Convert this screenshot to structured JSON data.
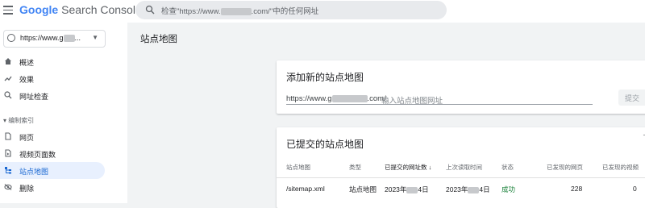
{
  "app": {
    "logo_google": "Google",
    "logo_product": "Search Console"
  },
  "search": {
    "placeholder_pre": "检查\"https://www.",
    "placeholder_post": ".com/\"中的任何网址"
  },
  "property": {
    "url_prefix": "https://www.g",
    "url_suffix": "..."
  },
  "sidebar": {
    "items": [
      {
        "label": "概述",
        "icon": "home-icon"
      },
      {
        "label": "效果",
        "icon": "trending-up-icon"
      },
      {
        "label": "网址检查",
        "icon": "search-icon"
      }
    ],
    "section_index": "编制索引",
    "index_items": [
      {
        "label": "网页",
        "icon": "file-icon"
      },
      {
        "label": "视频页面数",
        "icon": "video-file-icon"
      },
      {
        "label": "站点地图",
        "icon": "sitemap-icon",
        "active": true
      },
      {
        "label": "删除",
        "icon": "remove-visibility-icon"
      }
    ]
  },
  "page": {
    "title": "站点地图"
  },
  "add_card": {
    "title": "添加新的站点地图",
    "url_prefix_pre": "https://www.g",
    "url_prefix_post": ".com/",
    "input_placeholder": "输入站点地图网址",
    "submit_label": "提交"
  },
  "submitted_card": {
    "title": "已提交的站点地图",
    "columns": [
      "站点地图",
      "类型",
      "已提交的网址数",
      "上次读取时间",
      "状态",
      "已发现的网页",
      "已发现的视频"
    ],
    "sort_icon": "arrow-down-icon",
    "rows": [
      {
        "sitemap": "/sitemap.xml",
        "type": "站点地图",
        "submitted_pre": "2023年",
        "submitted_post": "4日",
        "last_read_pre": "2023年",
        "last_read_post": "4日",
        "status": "成功",
        "pages": "228",
        "videos": "0"
      }
    ]
  },
  "colors": {
    "accent": "#1967d2",
    "success": "#188038",
    "active_bg": "#e8f0fe"
  }
}
